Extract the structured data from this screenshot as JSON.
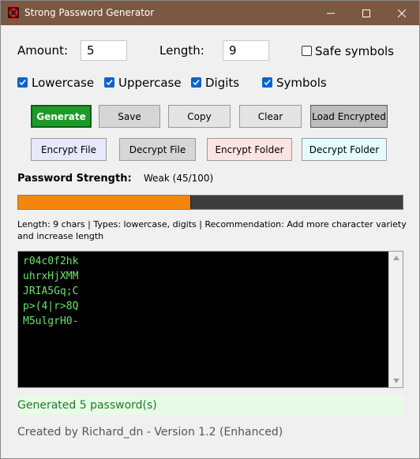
{
  "window": {
    "title": "Strong Password Generator",
    "titlebar_color": "#7b5841"
  },
  "controls": {
    "amount_label": "Amount:",
    "amount_value": "5",
    "length_label": "Length:",
    "length_value": "9",
    "safe_symbols_label": "Safe symbols",
    "safe_symbols_checked": false
  },
  "options": [
    {
      "label": "Lowercase",
      "checked": true
    },
    {
      "label": "Uppercase",
      "checked": true
    },
    {
      "label": "Digits",
      "checked": true
    },
    {
      "label": "Symbols",
      "checked": true
    }
  ],
  "buttons_row1": {
    "generate": "Generate",
    "save": "Save",
    "copy": "Copy",
    "clear": "Clear",
    "load_encrypted": "Load Encrypted"
  },
  "buttons_row2": {
    "encrypt_file": "Encrypt File",
    "decrypt_file": "Decrypt File",
    "encrypt_folder": "Encrypt Folder",
    "decrypt_folder": "Decrypt Folder"
  },
  "strength": {
    "label": "Password Strength:",
    "value": "Weak (45/100)",
    "progress_fraction": 0.45,
    "bar_color": "#f5860c"
  },
  "info_text": "Length: 9 chars | Types: lowercase, digits | Recommendation: Add more character variety and increase length",
  "output_lines": [
    "r04c0f2hk",
    "uhrxHjXMM",
    "JRIA5Gq;C",
    "p>(4|r>8Q",
    "M5ulgrH0-"
  ],
  "status": "Generated 5 password(s)",
  "footer": "Created by Richard_dn - Version 1.2 (Enhanced)"
}
